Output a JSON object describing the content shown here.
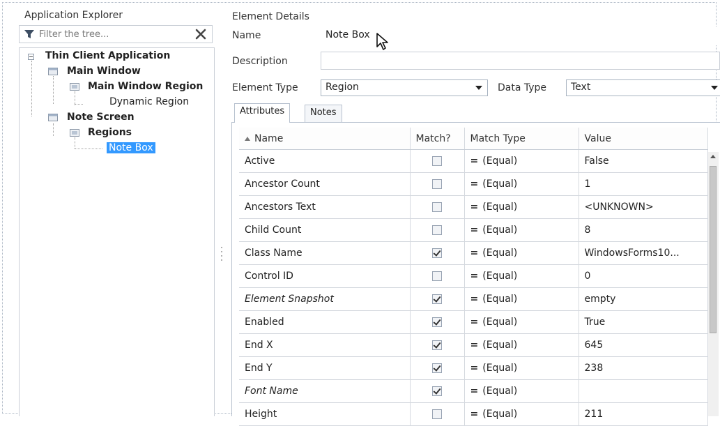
{
  "explorer": {
    "title": "Application Explorer",
    "filter_placeholder": "Filter the tree...",
    "filter_icon": "funnel-icon",
    "clear_icon": "close-x-icon",
    "tree": [
      {
        "label": "Thin Client Application",
        "level": 0,
        "bold": true,
        "icon": "collapse-toggle-icon"
      },
      {
        "label": "Main Window",
        "level": 1,
        "bold": true,
        "icon": "window-icon"
      },
      {
        "label": "Main Window Region",
        "level": 2,
        "bold": true,
        "icon": "region-icon"
      },
      {
        "label": "Dynamic Region",
        "level": 3,
        "bold": false
      },
      {
        "label": "Note Screen",
        "level": 1,
        "bold": true,
        "icon": "window-icon"
      },
      {
        "label": "Regions",
        "level": 2,
        "bold": true,
        "icon": "region-icon"
      },
      {
        "label": "Note Box",
        "level": 3,
        "bold": false,
        "selected": true
      }
    ]
  },
  "details": {
    "title": "Element Details",
    "name_label": "Name",
    "name_value": "Note Box",
    "description_label": "Description",
    "description_value": "",
    "element_type_label": "Element Type",
    "element_type_value": "Region",
    "data_type_label": "Data Type",
    "data_type_value": "Text",
    "tabs": [
      "Attributes",
      "Notes"
    ],
    "active_tab": "Attributes",
    "columns": [
      "Name",
      "Match?",
      "Match Type",
      "Value"
    ],
    "rows": [
      {
        "name": "Active",
        "match": false,
        "match_type": "(Equal)",
        "value": "False",
        "italic": false
      },
      {
        "name": "Ancestor Count",
        "match": false,
        "match_type": "(Equal)",
        "value": "1",
        "italic": false
      },
      {
        "name": "Ancestors Text",
        "match": false,
        "match_type": "(Equal)",
        "value": "<UNKNOWN>",
        "italic": false
      },
      {
        "name": "Child Count",
        "match": false,
        "match_type": "(Equal)",
        "value": "8",
        "italic": false
      },
      {
        "name": "Class Name",
        "match": true,
        "match_type": "(Equal)",
        "value": "WindowsForms10...",
        "italic": false
      },
      {
        "name": "Control ID",
        "match": false,
        "match_type": "(Equal)",
        "value": "0",
        "italic": false
      },
      {
        "name": "Element Snapshot",
        "match": true,
        "match_type": "(Equal)",
        "value": "empty",
        "italic": true
      },
      {
        "name": "Enabled",
        "match": true,
        "match_type": "(Equal)",
        "value": "True",
        "italic": false
      },
      {
        "name": "End X",
        "match": true,
        "match_type": "(Equal)",
        "value": "645",
        "italic": false
      },
      {
        "name": "End Y",
        "match": true,
        "match_type": "(Equal)",
        "value": "238",
        "italic": false
      },
      {
        "name": "Font Name",
        "match": true,
        "match_type": "(Equal)",
        "value": "",
        "italic": true
      },
      {
        "name": "Height",
        "match": false,
        "match_type": "(Equal)",
        "value": "211",
        "italic": false
      }
    ]
  }
}
